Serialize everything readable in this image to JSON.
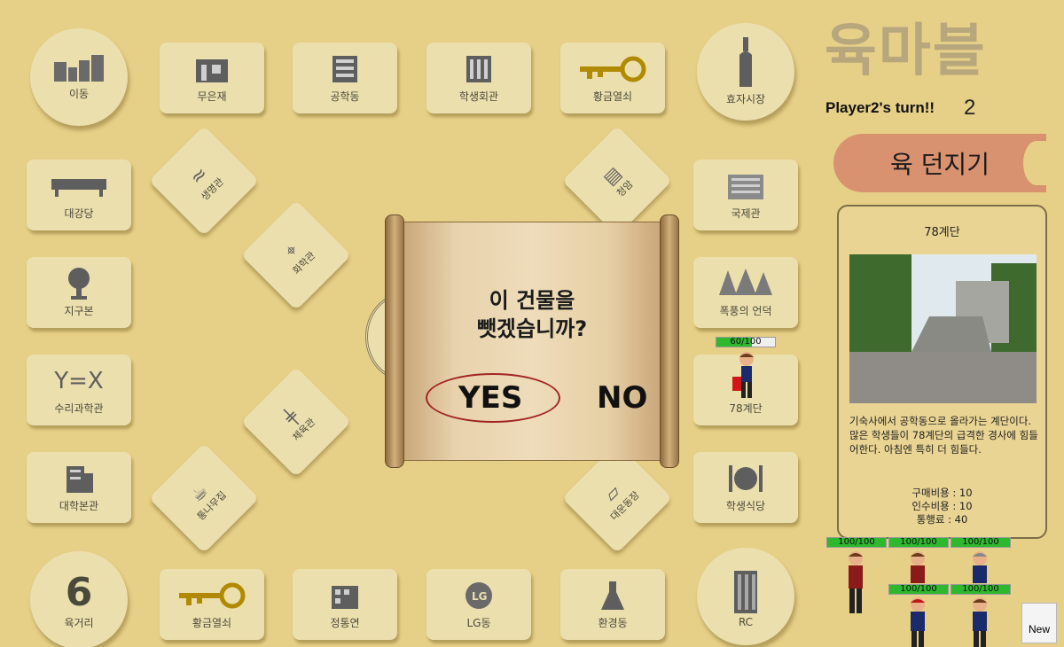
{
  "board": {
    "corners": {
      "tl": "이동",
      "tr": "효자시장",
      "bl_num": "6",
      "bl": "육거리",
      "br": "RC"
    },
    "top": [
      "무은재",
      "공학동",
      "학생회관",
      "황금열쇠"
    ],
    "left": [
      "대강당",
      "지구본",
      "수리과학관",
      "대학본관"
    ],
    "left_eq": "Y=X",
    "right": [
      "국제관",
      "폭풍의 언덕",
      "78계단",
      "학생식당"
    ],
    "bottom": [
      "황금열쇠",
      "정통연",
      "LG동",
      "환경동"
    ],
    "diag": [
      "생명관",
      "화학관",
      "체육관",
      "청암",
      "통나무집",
      "대운동장"
    ]
  },
  "dialog": {
    "question_l1": "이 건물을",
    "question_l2": "뺏겠습니까?",
    "yes": "YES",
    "no": "NO"
  },
  "side": {
    "title": "육마블",
    "turn": "Player2's turn!!",
    "turn_num": "2",
    "roll": "육 던지기",
    "info_title": "78계단",
    "info_desc": "기숙사에서 공학동으로 올라가는 계단이다. 많은 학생들이 78계단의 급격한 경사에 힘들어한다. 아침엔 특히 더 힘들다.",
    "cost_buy": "구매비용 : 10",
    "cost_take": "인수비용 : 10",
    "toll": "통행료 : 40"
  },
  "players": {
    "board_player_hp": "60/100",
    "board_player_hp_frac": 0.6,
    "hp": [
      "100/100",
      "100/100",
      "100/100",
      "100/100",
      "100/100"
    ]
  },
  "new_button": "New",
  "colors": {
    "background": "#e6cf86",
    "tile": "#ecdfae",
    "roll_button": "#d99270",
    "hp_green": "#2eb82e"
  }
}
